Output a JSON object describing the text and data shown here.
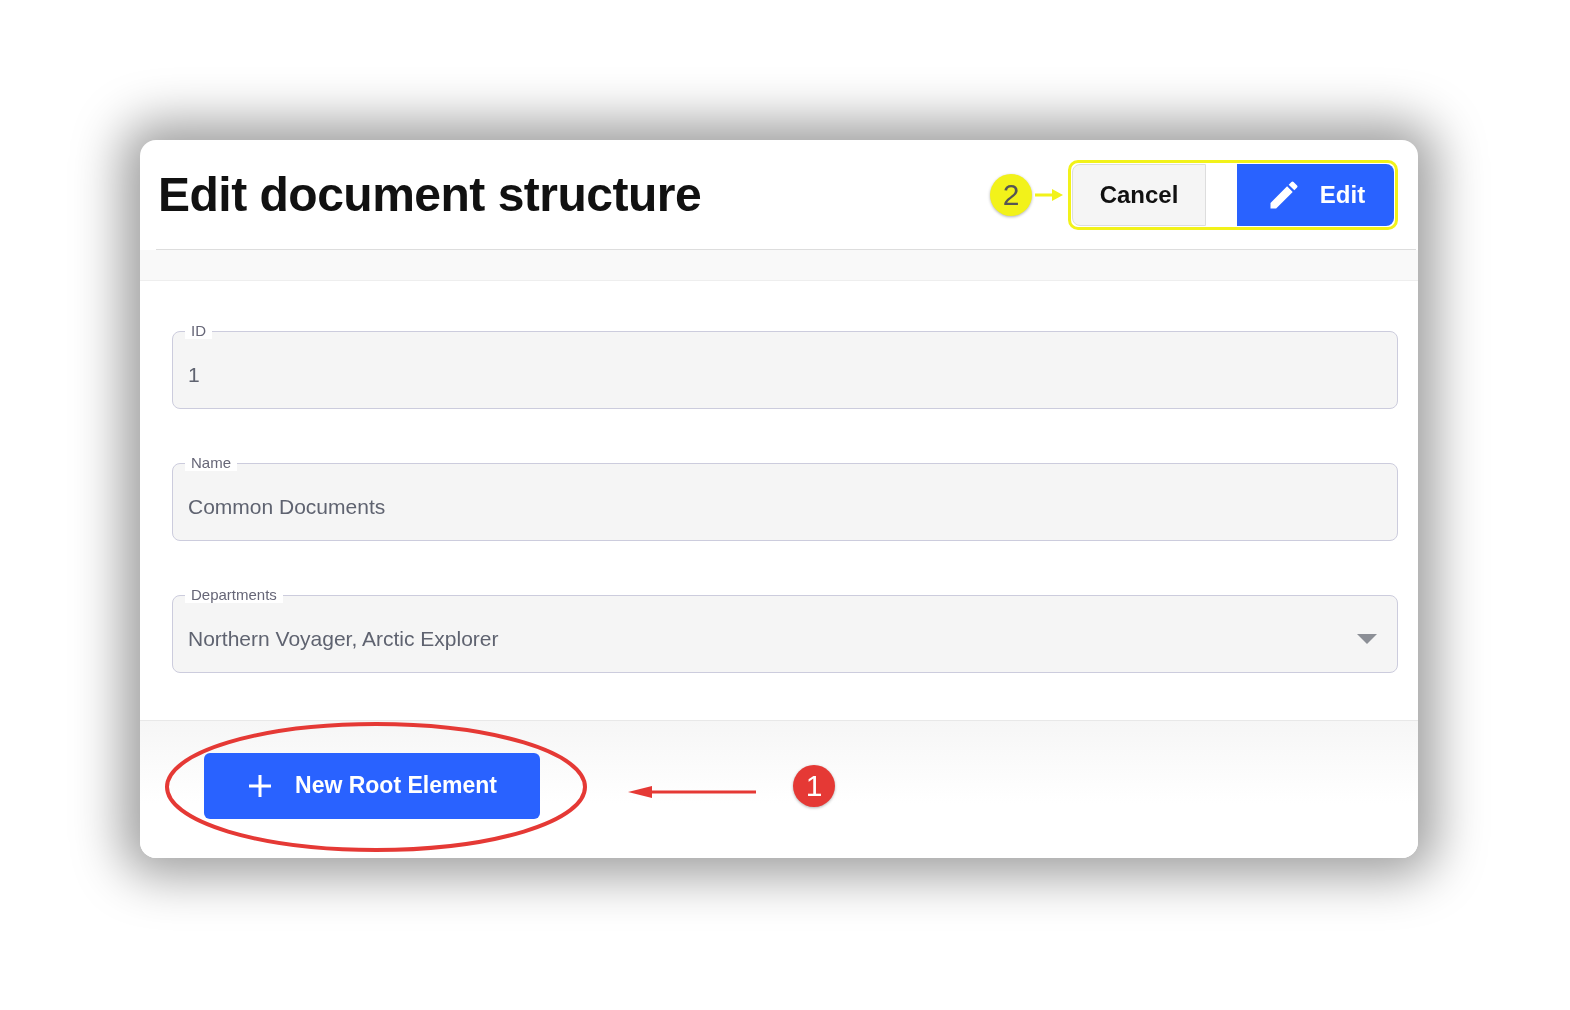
{
  "title": "Edit document structure",
  "header_buttons": [
    {
      "kind": "secondary",
      "label": "Cancel"
    },
    {
      "kind": "primary",
      "label": "Edit"
    }
  ],
  "fields": [
    {
      "kind": "text",
      "label": "ID",
      "value": "1"
    },
    {
      "kind": "text",
      "label": "Name",
      "value": "Common Documents"
    },
    {
      "kind": "select",
      "label": "Departments",
      "value": "Northern Voyager, Arctic Explorer"
    }
  ],
  "footer_button": {
    "label": "New Root Element"
  },
  "annotations": [
    {
      "number": "2",
      "color": "#f2f21a"
    },
    {
      "number": "1",
      "color": "#e53935"
    }
  ]
}
